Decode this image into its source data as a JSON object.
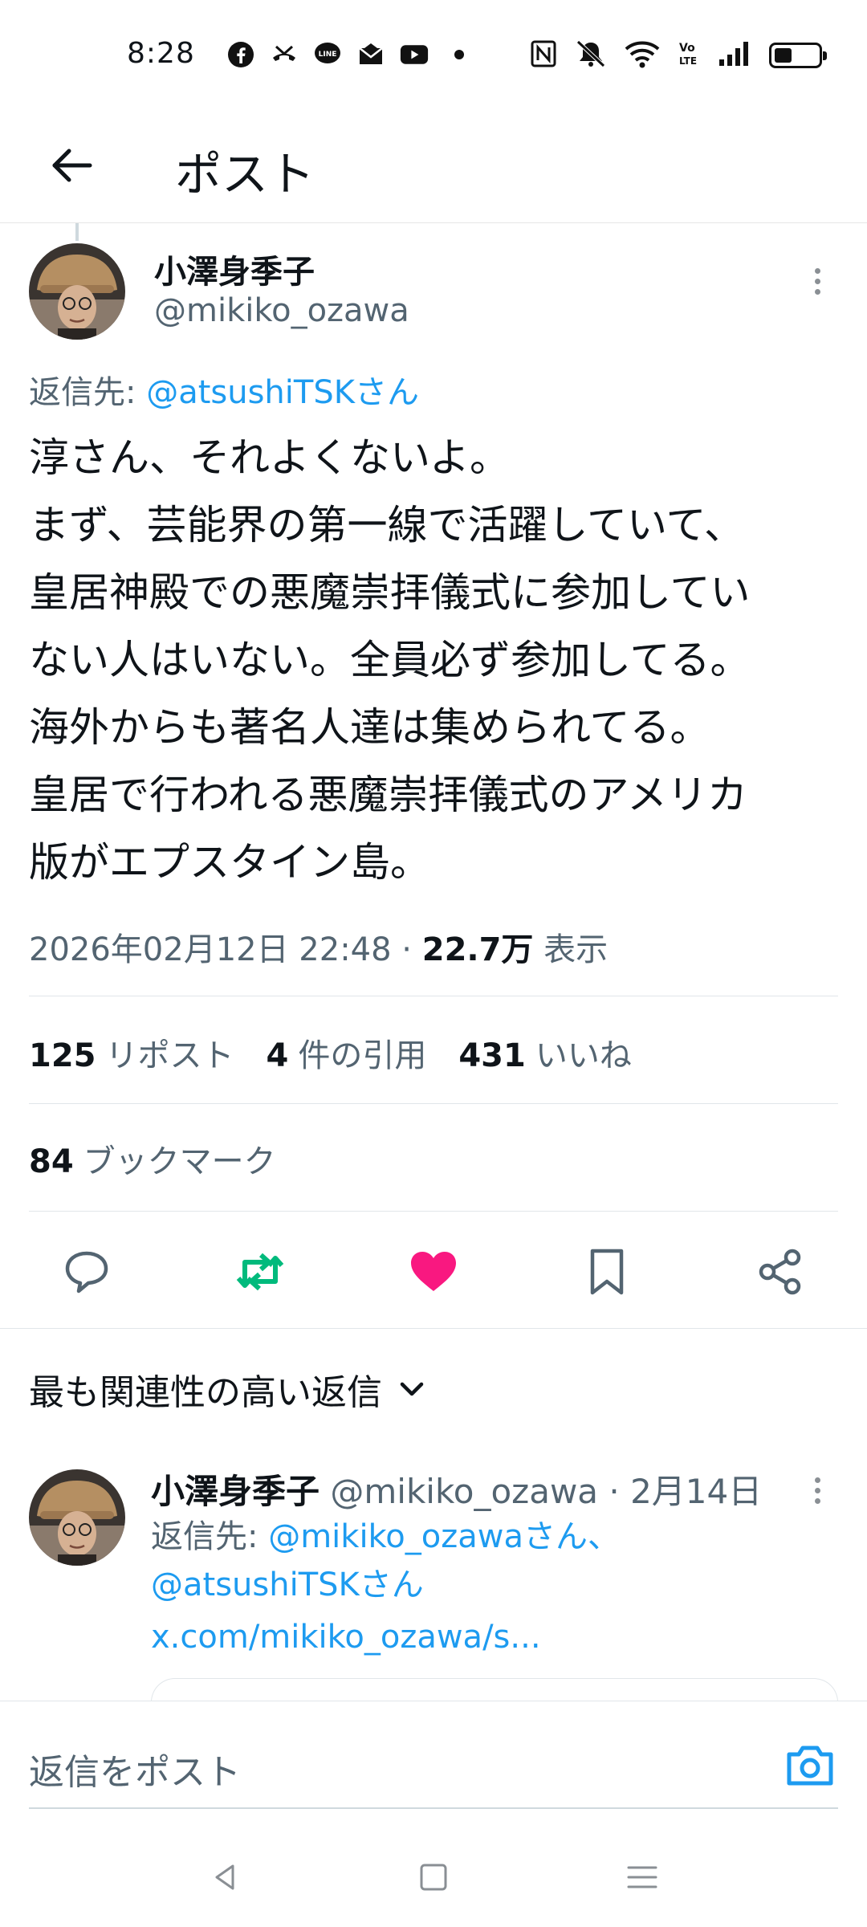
{
  "status_bar": {
    "time": "8:28",
    "app_icons": [
      "facebook-icon",
      "missed-call-icon",
      "line-icon",
      "mail-icon",
      "youtube-icon"
    ],
    "system_icons": [
      "nfc-icon",
      "mute-icon",
      "wifi-icon",
      "volte-icon",
      "signal-icon",
      "battery-icon"
    ],
    "battery_level": 0.4,
    "volte_label": "Vo LTE"
  },
  "header": {
    "title": "ポスト",
    "back_icon": "arrow-left-icon"
  },
  "post": {
    "author_name": "小澤身季子",
    "handle": "@mikiko_ozawa",
    "reply_label": "返信先: ",
    "reply_mention": "@atsushiTSKさん",
    "text_lines": [
      "淳さん、それよくないよ。",
      "まず、芸能界の第一線で活躍していて、",
      "皇居神殿での悪魔崇拝儀式に参加してい",
      "ない人はいない。全員必ず参加してる。",
      "海外からも著名人達は集められてる。",
      "皇居で行われる悪魔崇拝儀式のアメリカ",
      "版がエプスタイン島。"
    ],
    "timestamp": "2026年02月12日 22:48 · ",
    "views_count": "22.7万",
    "views_label": " 表示"
  },
  "stats": {
    "reposts_count": "125",
    "reposts_label": "リポスト",
    "quotes_count": "4",
    "quotes_label": "件の引用",
    "likes_count": "431",
    "likes_label": "いいね",
    "bookmarks_count": "84",
    "bookmarks_label": "ブックマーク"
  },
  "actions": {
    "reply_icon": "comment-icon",
    "repost_icon": "repost-icon",
    "like_icon": "heart-icon",
    "bookmark_icon": "bookmark-icon",
    "share_icon": "share-icon",
    "colors": {
      "repost": "#00ba7c",
      "like": "#f91880",
      "default": "#536471"
    }
  },
  "replies_section": {
    "sort_label": "最も関連性の高い返信"
  },
  "reply": {
    "author_name": "小澤身季子",
    "meta": " @mikiko_ozawa · 2月14日",
    "reply_label": "返信先: ",
    "mention1": "@mikiko_ozawaさん、",
    "mention2": "@atsushiTSKさん",
    "link": "x.com/mikiko_ozawa/s..."
  },
  "compose": {
    "placeholder": "返信をポスト",
    "camera_icon": "camera-icon",
    "accent": "#1d9bf0"
  },
  "navbar": {
    "icons": [
      "back-triangle-icon",
      "home-square-icon",
      "menu-lines-icon"
    ]
  }
}
